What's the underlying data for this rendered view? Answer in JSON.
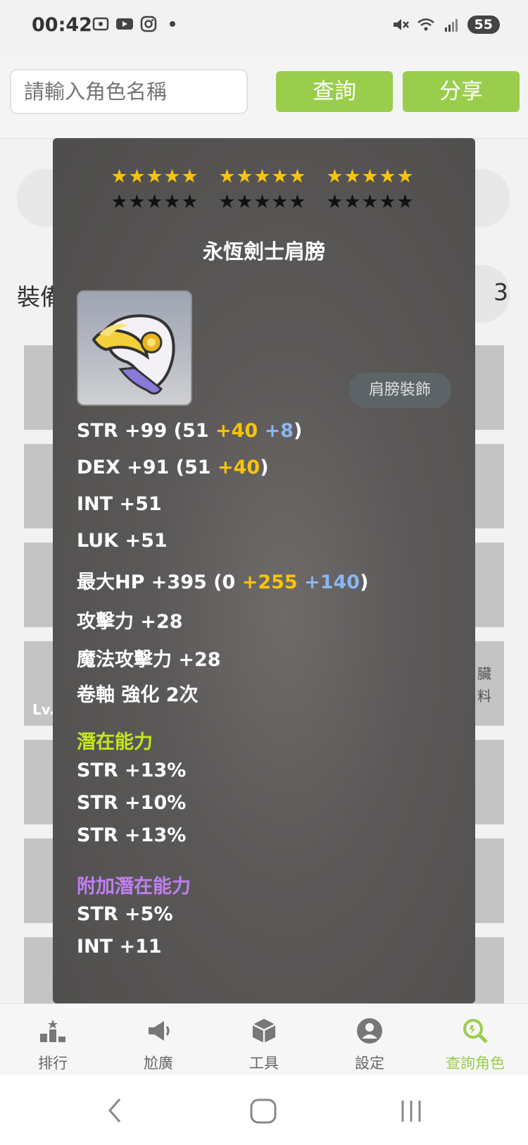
{
  "status_bar": {
    "time": "00:42",
    "battery": "55"
  },
  "search": {
    "placeholder": "請輸入角色名稱",
    "query_label": "查詢",
    "share_label": "分享"
  },
  "background": {
    "equipment_heading": "裝備",
    "count_suffix": "3",
    "side_label_line1": "臟",
    "side_label_line2": "料",
    "level_prefix": "Lv."
  },
  "item": {
    "stars_rows": [
      {
        "color": "gold",
        "groups": [
          5,
          5,
          5
        ]
      },
      {
        "color": "black",
        "groups": [
          5,
          5,
          5
        ]
      }
    ],
    "name": "永恆劍士肩膀",
    "type": "肩膀裝飾",
    "stats": {
      "str": {
        "label": "STR +99 (51 ",
        "extra1": "+40",
        "extra2": "+8",
        "close": ")"
      },
      "dex": {
        "label": "DEX +91 (51 ",
        "extra1": "+40",
        "close": ")"
      },
      "int": "INT +51",
      "luk": "LUK +51",
      "hp": {
        "label": "最大HP +395 (0 ",
        "extra1": "+255",
        "extra2": "+140",
        "close": ")"
      },
      "attack": "攻擊力 +28",
      "magic_attack": "魔法攻擊力 +28",
      "scroll": "卷軸 強化 2次"
    },
    "potential": {
      "title": "潛在能力",
      "lines": [
        "STR +13%",
        "STR +10%",
        "STR +13%"
      ]
    },
    "bonus_potential": {
      "title": "附加潛在能力",
      "lines": [
        "STR +5%",
        "INT +11"
      ]
    }
  },
  "bottom_nav": {
    "items": [
      {
        "label": "排行",
        "icon": "ranking-icon"
      },
      {
        "label": "尬廣",
        "icon": "megaphone-icon"
      },
      {
        "label": "工具",
        "icon": "cube-icon"
      },
      {
        "label": "設定",
        "icon": "user-icon"
      },
      {
        "label": "查詢角色",
        "icon": "search-character-icon"
      }
    ],
    "active_index": 4
  },
  "colors": {
    "accent_green": "#9acd4c",
    "star_gold": "#f7c40a",
    "potential_green": "#c6e51f",
    "bonus_purple": "#c07ff0",
    "blue_bonus": "#8ab6f0"
  }
}
